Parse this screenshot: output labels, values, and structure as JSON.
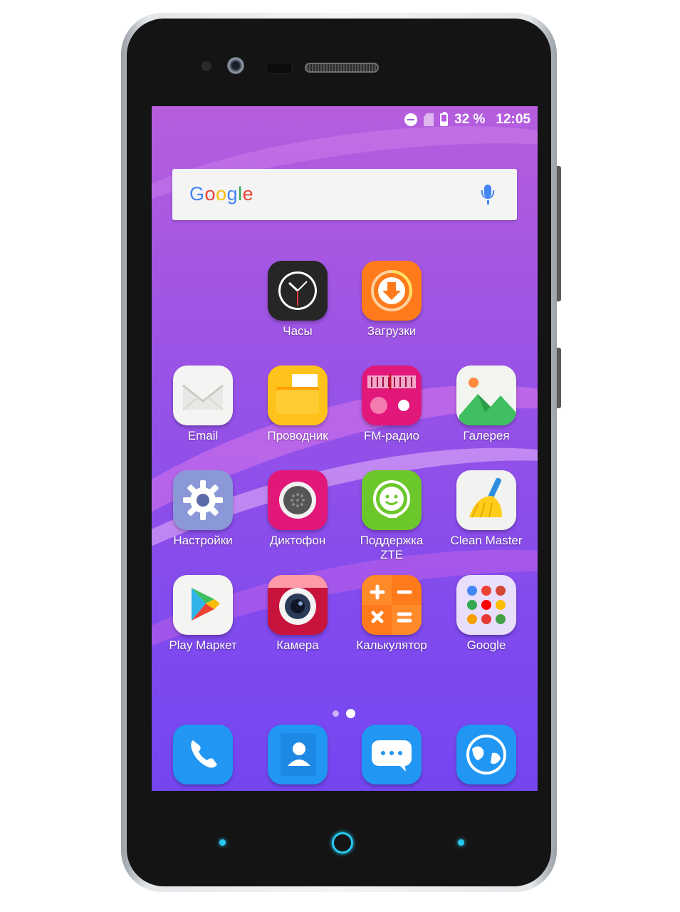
{
  "status_bar": {
    "battery": "32 %",
    "time": "12:05"
  },
  "search": {
    "logo": "Google"
  },
  "top_apps": [
    {
      "label": "Часы",
      "icon": "clock-icon"
    },
    {
      "label": "Загрузки",
      "icon": "download-icon"
    }
  ],
  "grid_apps": [
    {
      "label": "Email",
      "icon": "email-icon"
    },
    {
      "label": "Проводник",
      "icon": "folder-icon"
    },
    {
      "label": "FM-радио",
      "icon": "radio-icon"
    },
    {
      "label": "Галерея",
      "icon": "gallery-icon"
    },
    {
      "label": "Настройки",
      "icon": "gear-icon"
    },
    {
      "label": "Диктофон",
      "icon": "recorder-icon"
    },
    {
      "label": "Поддержка ZTE",
      "icon": "support-icon"
    },
    {
      "label": "Clean Master",
      "icon": "broom-icon"
    },
    {
      "label": "Play Маркет",
      "icon": "play-store-icon"
    },
    {
      "label": "Камера",
      "icon": "camera-icon"
    },
    {
      "label": "Калькулятор",
      "icon": "calculator-icon"
    },
    {
      "label": "Google",
      "icon": "google-folder-icon"
    }
  ],
  "dock_apps": [
    {
      "icon": "phone-icon"
    },
    {
      "icon": "contacts-icon"
    },
    {
      "icon": "messages-icon"
    },
    {
      "icon": "browser-icon"
    }
  ],
  "page_indicator": {
    "pages": 2,
    "current": 2
  },
  "colors": {
    "accent": "#29c8f0",
    "wallpaper": "#9a52e6",
    "status_text": "#ffffff"
  }
}
